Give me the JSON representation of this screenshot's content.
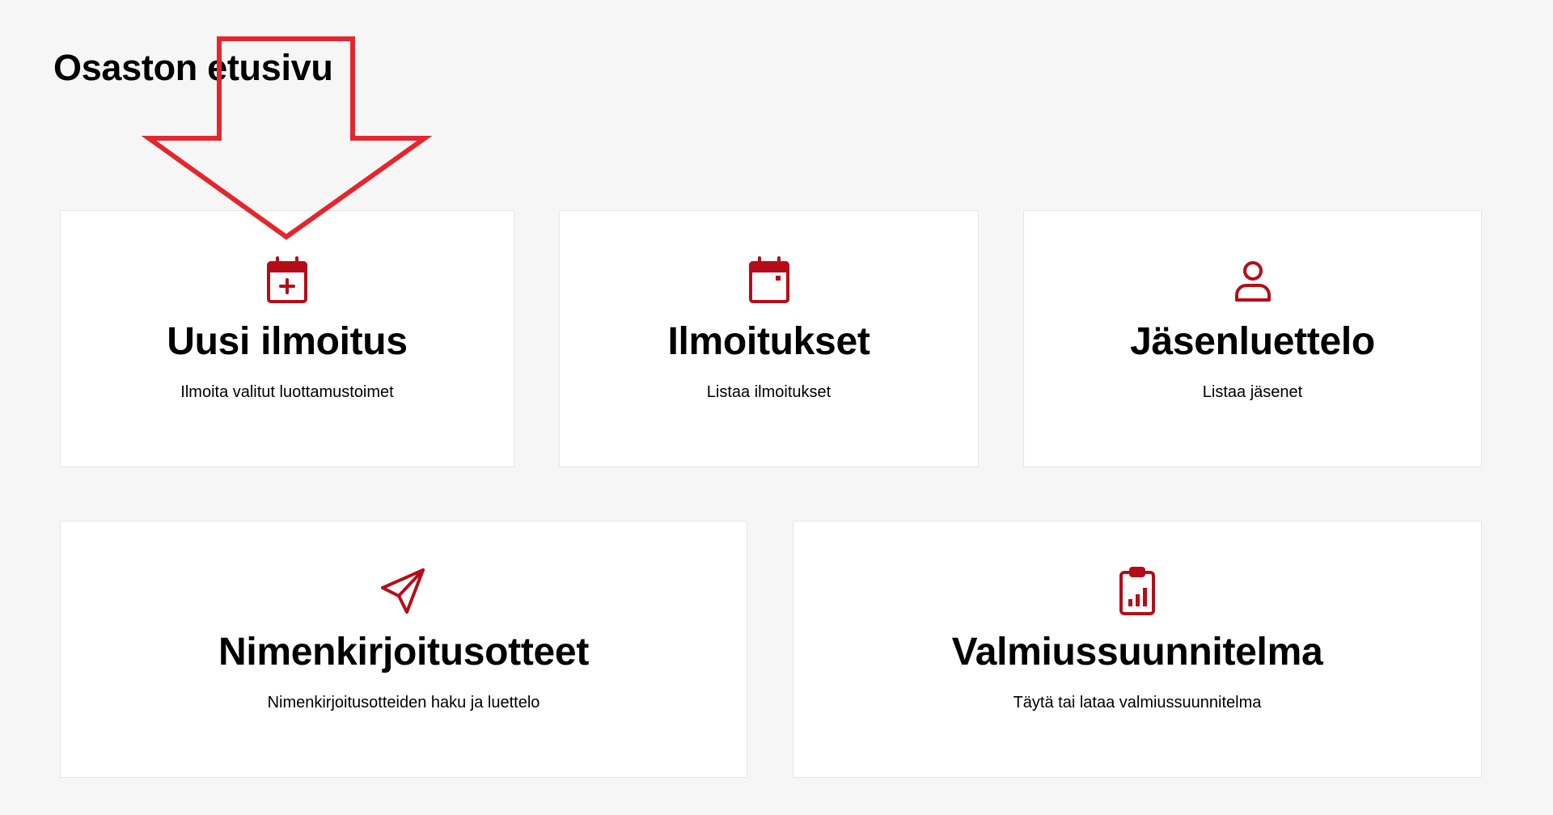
{
  "page": {
    "title": "Osaston etusivu"
  },
  "colors": {
    "accent": "#b50d18",
    "annotation": "#e4262f",
    "background": "#f6f6f6",
    "card": "#ffffff"
  },
  "cards": [
    {
      "icon": "calendar-plus-icon",
      "title": "Uusi ilmoitus",
      "description": "Ilmoita valitut luottamustoimet"
    },
    {
      "icon": "calendar-icon",
      "title": "Ilmoitukset",
      "description": "Listaa ilmoitukset"
    },
    {
      "icon": "user-icon",
      "title": "Jäsenluettelo",
      "description": "Listaa jäsenet"
    },
    {
      "icon": "paper-plane-icon",
      "title": "Nimenkirjoitusotteet",
      "description": "Nimenkirjoitusotteiden haku ja luettelo"
    },
    {
      "icon": "clipboard-chart-icon",
      "title": "Valmiussuunnitelma",
      "description": "Täytä tai lataa valmiussuunnitelma"
    }
  ],
  "annotation": {
    "icon": "down-arrow-annotation-icon"
  }
}
